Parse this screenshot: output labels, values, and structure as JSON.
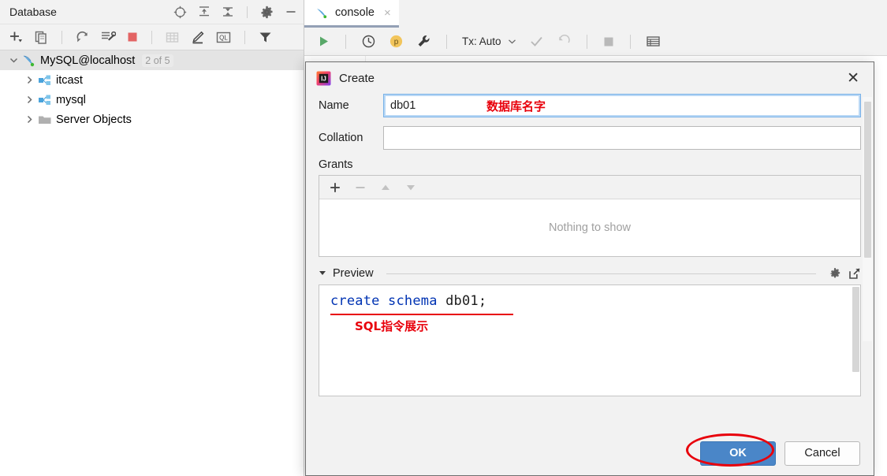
{
  "db_panel": {
    "title": "Database",
    "header_icons": [
      {
        "name": "locate-icon",
        "glyph": "⊕"
      },
      {
        "name": "expand-all-icon",
        "glyph": "↑"
      },
      {
        "name": "collapse-all-icon",
        "glyph": "↓"
      },
      {
        "name": "settings-gear-icon",
        "glyph": "⚙"
      },
      {
        "name": "minimize-icon",
        "glyph": "—"
      }
    ],
    "toolbar_icons": [
      {
        "name": "add-icon",
        "glyph": "+"
      },
      {
        "name": "duplicate-icon",
        "glyph": "❐"
      },
      {
        "name": "refresh-icon",
        "glyph": "↻"
      },
      {
        "name": "synchronize-icon",
        "glyph": "⚒"
      },
      {
        "name": "stop-icon",
        "glyph": "■"
      },
      {
        "name": "table-editor-icon",
        "glyph": "▦"
      },
      {
        "name": "modify-icon",
        "glyph": "✎"
      },
      {
        "name": "query-console-icon",
        "glyph": "QL"
      },
      {
        "name": "filter-icon",
        "glyph": "▼"
      }
    ],
    "tree": [
      {
        "label": "MySQL@localhost",
        "badge": "2 of 5",
        "icon": "mysql-dolphin-icon",
        "expanded": true,
        "level": 0,
        "selected": true
      },
      {
        "label": "itcast",
        "badge": "",
        "icon": "schema-icon",
        "expanded": false,
        "level": 1,
        "selected": false
      },
      {
        "label": "mysql",
        "badge": "",
        "icon": "schema-icon",
        "expanded": false,
        "level": 1,
        "selected": false
      },
      {
        "label": "Server Objects",
        "badge": "",
        "icon": "folder-icon",
        "expanded": false,
        "level": 1,
        "selected": false
      }
    ]
  },
  "editor": {
    "tab": {
      "label": "console",
      "icon": "mysql-dolphin-icon",
      "close": "×"
    },
    "toolbar": {
      "run_icon": "▶",
      "history_icon": "◷",
      "profile_icon": "p",
      "wrench_icon": "⚒",
      "tx_label": "Tx: Auto",
      "tx_caret": "∨",
      "commit_icon": "✓",
      "rollback_icon": "↺",
      "stop_icon": "■",
      "table_icon": "⌸"
    }
  },
  "dialog": {
    "title": "Create",
    "app_icon": "intellij-idea-icon",
    "close_label": "✕",
    "name": {
      "label": "Name",
      "value": "db01",
      "placeholder": "",
      "annotation": "数据库名字"
    },
    "collation": {
      "label": "Collation",
      "value": "",
      "placeholder": ""
    },
    "grants": {
      "label": "Grants",
      "empty_text": "Nothing to show",
      "toolbar": [
        {
          "name": "add-grant-icon",
          "glyph": "+"
        },
        {
          "name": "remove-grant-icon",
          "glyph": "−"
        },
        {
          "name": "move-up-icon",
          "glyph": "▲"
        },
        {
          "name": "move-down-icon",
          "glyph": "▼"
        }
      ]
    },
    "preview": {
      "label": "Preview",
      "caret": "▼",
      "icons": [
        {
          "name": "preview-settings-gear-icon",
          "glyph": "⚙"
        },
        {
          "name": "open-in-editor-icon",
          "glyph": "↗"
        }
      ],
      "sql_keywords": "create schema",
      "sql_rest": " db01;",
      "annotation": "SQL指令展示"
    },
    "buttons": {
      "ok": "OK",
      "cancel": "Cancel"
    }
  },
  "colors": {
    "accent_blue": "#4a86c8",
    "annotation_red": "#e8000b",
    "sql_keyword_blue": "#0033b3",
    "panel_gray": "#f2f2f2",
    "selection_gray": "#e4e4e4"
  }
}
